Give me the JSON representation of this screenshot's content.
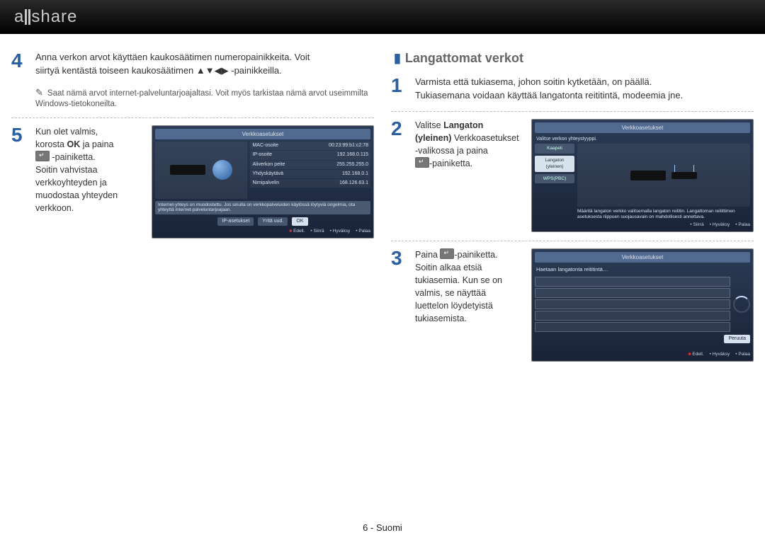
{
  "header": {
    "logo_text": "a  share"
  },
  "left": {
    "step4": {
      "num": "4",
      "line1": "Anna verkon arvot käyttäen kaukosäätimen numeropainikkeita. Voit",
      "line2": "siirtyä kentästä toiseen kaukosäätimen ▲▼◀▶ -painikkeilla.",
      "note": "Saat nämä arvot internet-palveluntarjoajaltasi. Voit myös tarkistaa nämä arvot useimmilta Windows-tietokoneilta."
    },
    "step5": {
      "num": "5",
      "text_a": "Kun olet valmis,",
      "text_b": "korosta ",
      "text_b_bold": "OK",
      "text_b2": " ja paina",
      "text_c": " -painiketta.",
      "text_d": "Soitin vahvistaa verkkoyhteyden ja muodostaa yhteyden verkkoon."
    },
    "shot5": {
      "title": "Verkkoasetukset",
      "rows": [
        [
          "MAC-osoite",
          "00:23:99:b1:c2:78"
        ],
        [
          "IP-osoite",
          "192.168.0.115"
        ],
        [
          "Aliverkon peite",
          "255.255.255.0"
        ],
        [
          "Yhdyskäytävä",
          "192.168.0.1"
        ],
        [
          "Nimipalvelin",
          "168.126.63.1"
        ]
      ],
      "hint": "Internet-yhteys on muodostettu. Jos sinulla on verkkopalveluiden käytössä löytyviä ongelmia, ota yhteyttä Internet-palveluntarjoajaan.",
      "btn_ip": "IP-asetukset",
      "btn_retry": "Yritä uud.",
      "btn_ok": "OK",
      "foot": {
        "a": "Edell.",
        "b": "Siirrä",
        "c": "Hyväksy",
        "d": "Palaa"
      }
    }
  },
  "right": {
    "section_title": "Langattomat verkot",
    "step1": {
      "num": "1",
      "line1": "Varmista että tukiasema, johon soitin kytketään, on päällä.",
      "line2": "Tukiasemana voidaan käyttää langatonta reititintä, modeemia jne."
    },
    "step2": {
      "num": "2",
      "t1": "Valitse ",
      "t1b": "Langaton",
      "t2a": "(yleinen)",
      "t2b": " Verkkoasetukset",
      "t3": "-valikossa ja paina",
      "t4": "-painiketta."
    },
    "shot2": {
      "title": "Verkkoasetukset",
      "caption": "Valitse verkon yhteystyyppi.",
      "opt_cable": "Kaapeli",
      "opt_wlan": "Langaton (yleinen)",
      "opt_wps": "WPS(PBC)",
      "info": "Määritä langaton verkko valitsemalla langaton reititin. Langattoman reitittimen asetuksesta riippuen suojausavain on mahdollisesti annettava.",
      "foot": {
        "b": "Siirrä",
        "c": "Hyväksy",
        "d": "Palaa"
      }
    },
    "step3": {
      "num": "3",
      "t1": "Paina ",
      "t2": "-painiketta.",
      "t3": "Soitin alkaa etsiä tukiasemia. Kun se on valmis, se näyttää luettelon löydetyistä tukiasemista."
    },
    "shot3": {
      "title": "Verkkoasetukset",
      "caption": "Haetaan langatonta reititintä…",
      "btn_cancel": "Peruuta",
      "foot": {
        "a": "Edell.",
        "c": "Hyväksy",
        "d": "Palaa"
      }
    }
  },
  "footer": "6 - Suomi"
}
